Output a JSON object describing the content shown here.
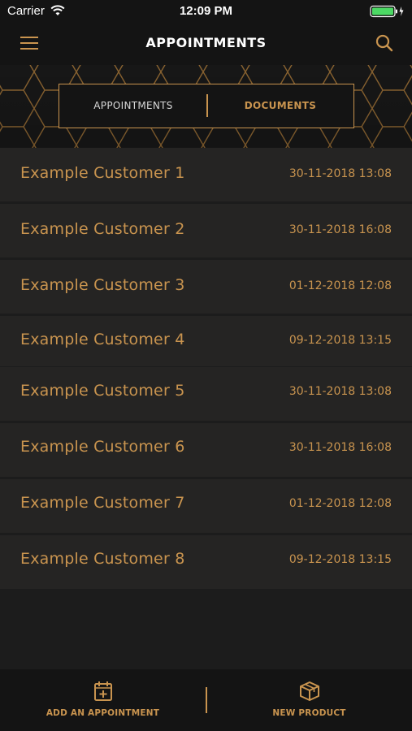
{
  "status_bar": {
    "carrier": "Carrier",
    "time": "12:09 PM"
  },
  "nav": {
    "title": "APPOINTMENTS",
    "menu_icon": "hamburger-menu-icon",
    "search_icon": "search-icon"
  },
  "segmented": {
    "left_label": "APPOINTMENTS",
    "right_label": "DOCUMENTS",
    "selected": "DOCUMENTS"
  },
  "customers": [
    {
      "name": "Example Customer 1",
      "date": "30-11-2018 13:08"
    },
    {
      "name": "Example Customer 2",
      "date": "30-11-2018 16:08"
    },
    {
      "name": "Example Customer 3",
      "date": "01-12-2018 12:08"
    },
    {
      "name": "Example Customer 4",
      "date": "09-12-2018 13:15"
    },
    {
      "name": "Example Customer 5",
      "date": "30-11-2018 13:08"
    },
    {
      "name": "Example Customer 6",
      "date": "30-11-2018 16:08"
    },
    {
      "name": "Example Customer 7",
      "date": "01-12-2018 12:08"
    },
    {
      "name": "Example Customer 8",
      "date": "09-12-2018 13:15"
    }
  ],
  "tab_bar": {
    "add_label": "ADD AN APPOINTMENT",
    "add_icon": "calendar-plus-icon",
    "product_label": "NEW PRODUCT",
    "product_icon": "box-icon"
  },
  "colors": {
    "accent": "#c9944f",
    "background": "#1c1c1c",
    "row": "#252423",
    "bar": "#141414"
  }
}
